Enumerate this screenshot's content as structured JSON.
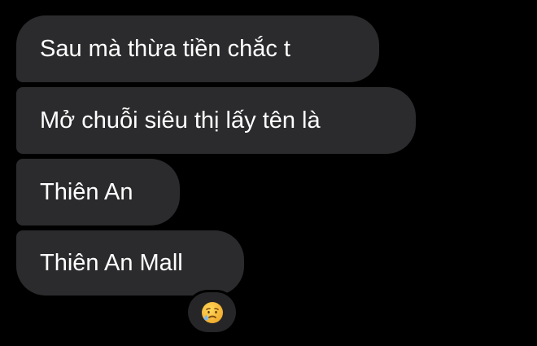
{
  "messages": [
    {
      "text": "Sau mà thừa tiền chắc t"
    },
    {
      "text": "Mở chuỗi siêu thị lấy tên là"
    },
    {
      "text": "Thiên An"
    },
    {
      "text": "Thiên An Mall"
    }
  ],
  "reaction": {
    "icon": "crying-face-emoji-icon",
    "colors": {
      "face": "#f7c23a",
      "tear": "#6fb7ff"
    }
  },
  "colors": {
    "background": "#000000",
    "bubble": "#2b2b2d",
    "text": "#ffffff"
  }
}
